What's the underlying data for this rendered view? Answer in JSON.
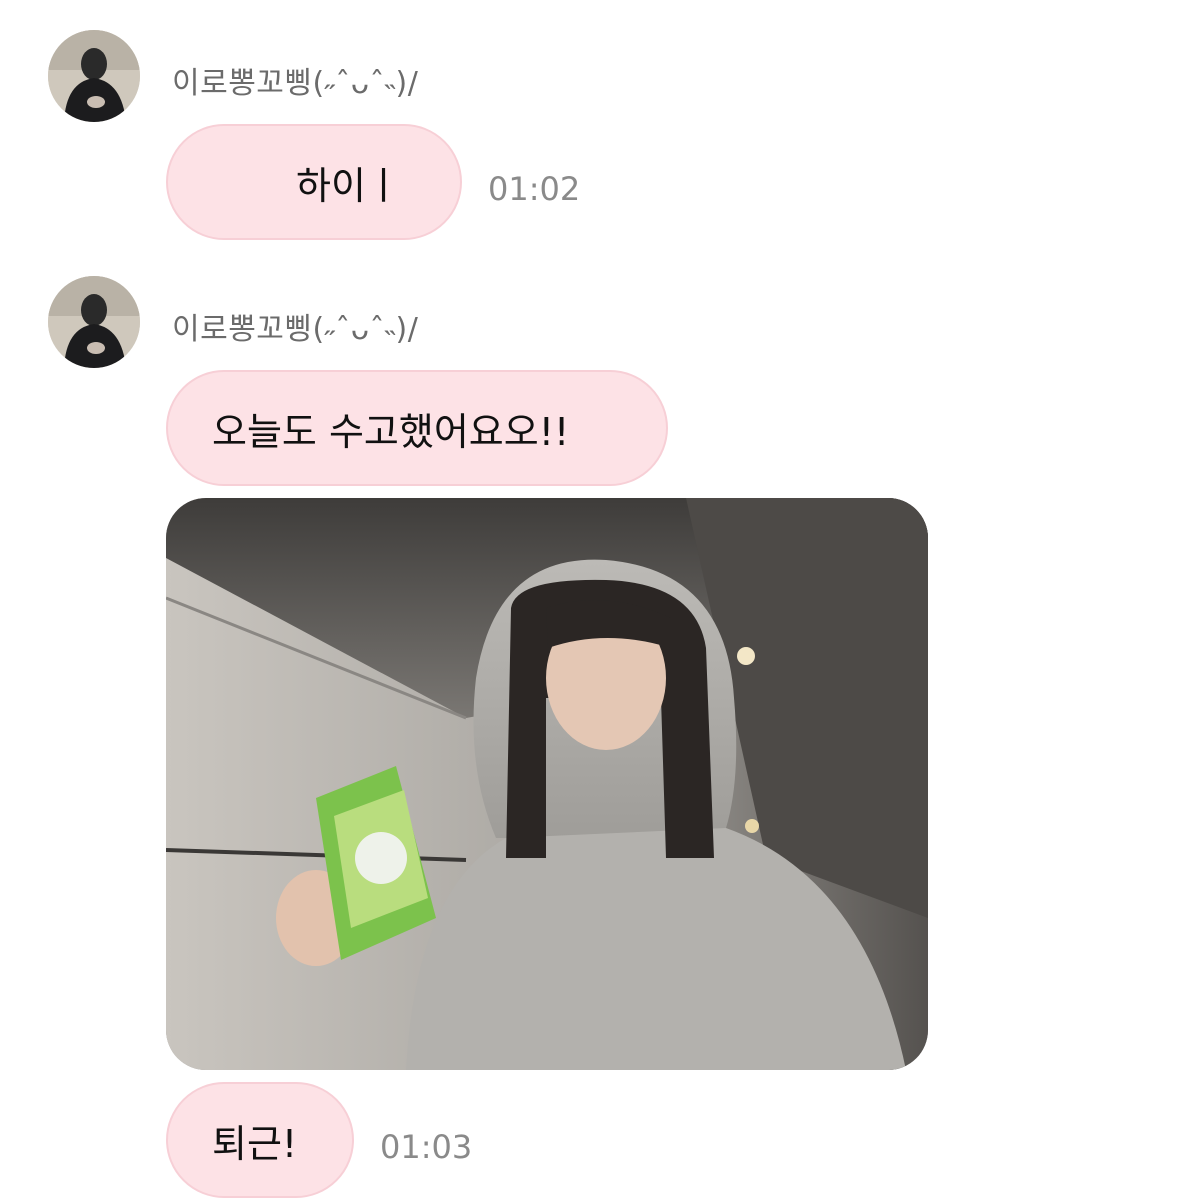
{
  "messages": [
    {
      "sender": "이로뽕꼬삥(˶ˆᴗˆ˵)/",
      "text": "하이ㅣ",
      "time": "01:02"
    },
    {
      "sender": "이로뽕꼬삥(˶ˆᴗˆ˵)/",
      "text": "오늘도 수고했어요오!!",
      "text2": "퇴근!",
      "time": "01:03"
    }
  ],
  "colors": {
    "bubble": "#fde2e6",
    "bubble_border": "#f7cfd6",
    "sender_text": "#6b6b6b",
    "time_text": "#8a8a8a"
  }
}
